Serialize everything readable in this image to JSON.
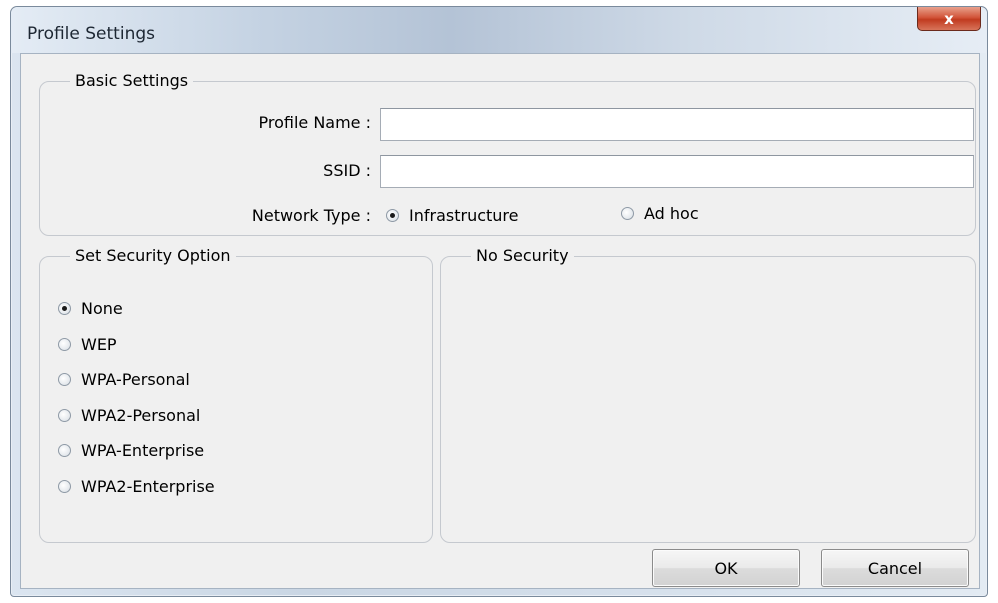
{
  "window": {
    "title": "Profile Settings",
    "close_label": "x"
  },
  "basic": {
    "legend": "Basic Settings",
    "profile_name_label": "Profile Name :",
    "profile_name_value": "",
    "ssid_label": "SSID :",
    "ssid_value": "",
    "network_type_label": "Network Type :",
    "network_types": [
      {
        "label": "Infrastructure",
        "checked": true
      },
      {
        "label": "Ad hoc",
        "checked": false
      }
    ]
  },
  "security": {
    "legend": "Set Security Option",
    "options": [
      {
        "label": "None",
        "checked": true
      },
      {
        "label": "WEP",
        "checked": false
      },
      {
        "label": "WPA-Personal",
        "checked": false
      },
      {
        "label": "WPA2-Personal",
        "checked": false
      },
      {
        "label": "WPA-Enterprise",
        "checked": false
      },
      {
        "label": "WPA2-Enterprise",
        "checked": false
      }
    ]
  },
  "detail": {
    "legend": "No Security"
  },
  "buttons": {
    "ok": "OK",
    "cancel": "Cancel"
  },
  "colors": {
    "close_button": "#c9452a",
    "dialog_background": "#f0f0f0"
  }
}
